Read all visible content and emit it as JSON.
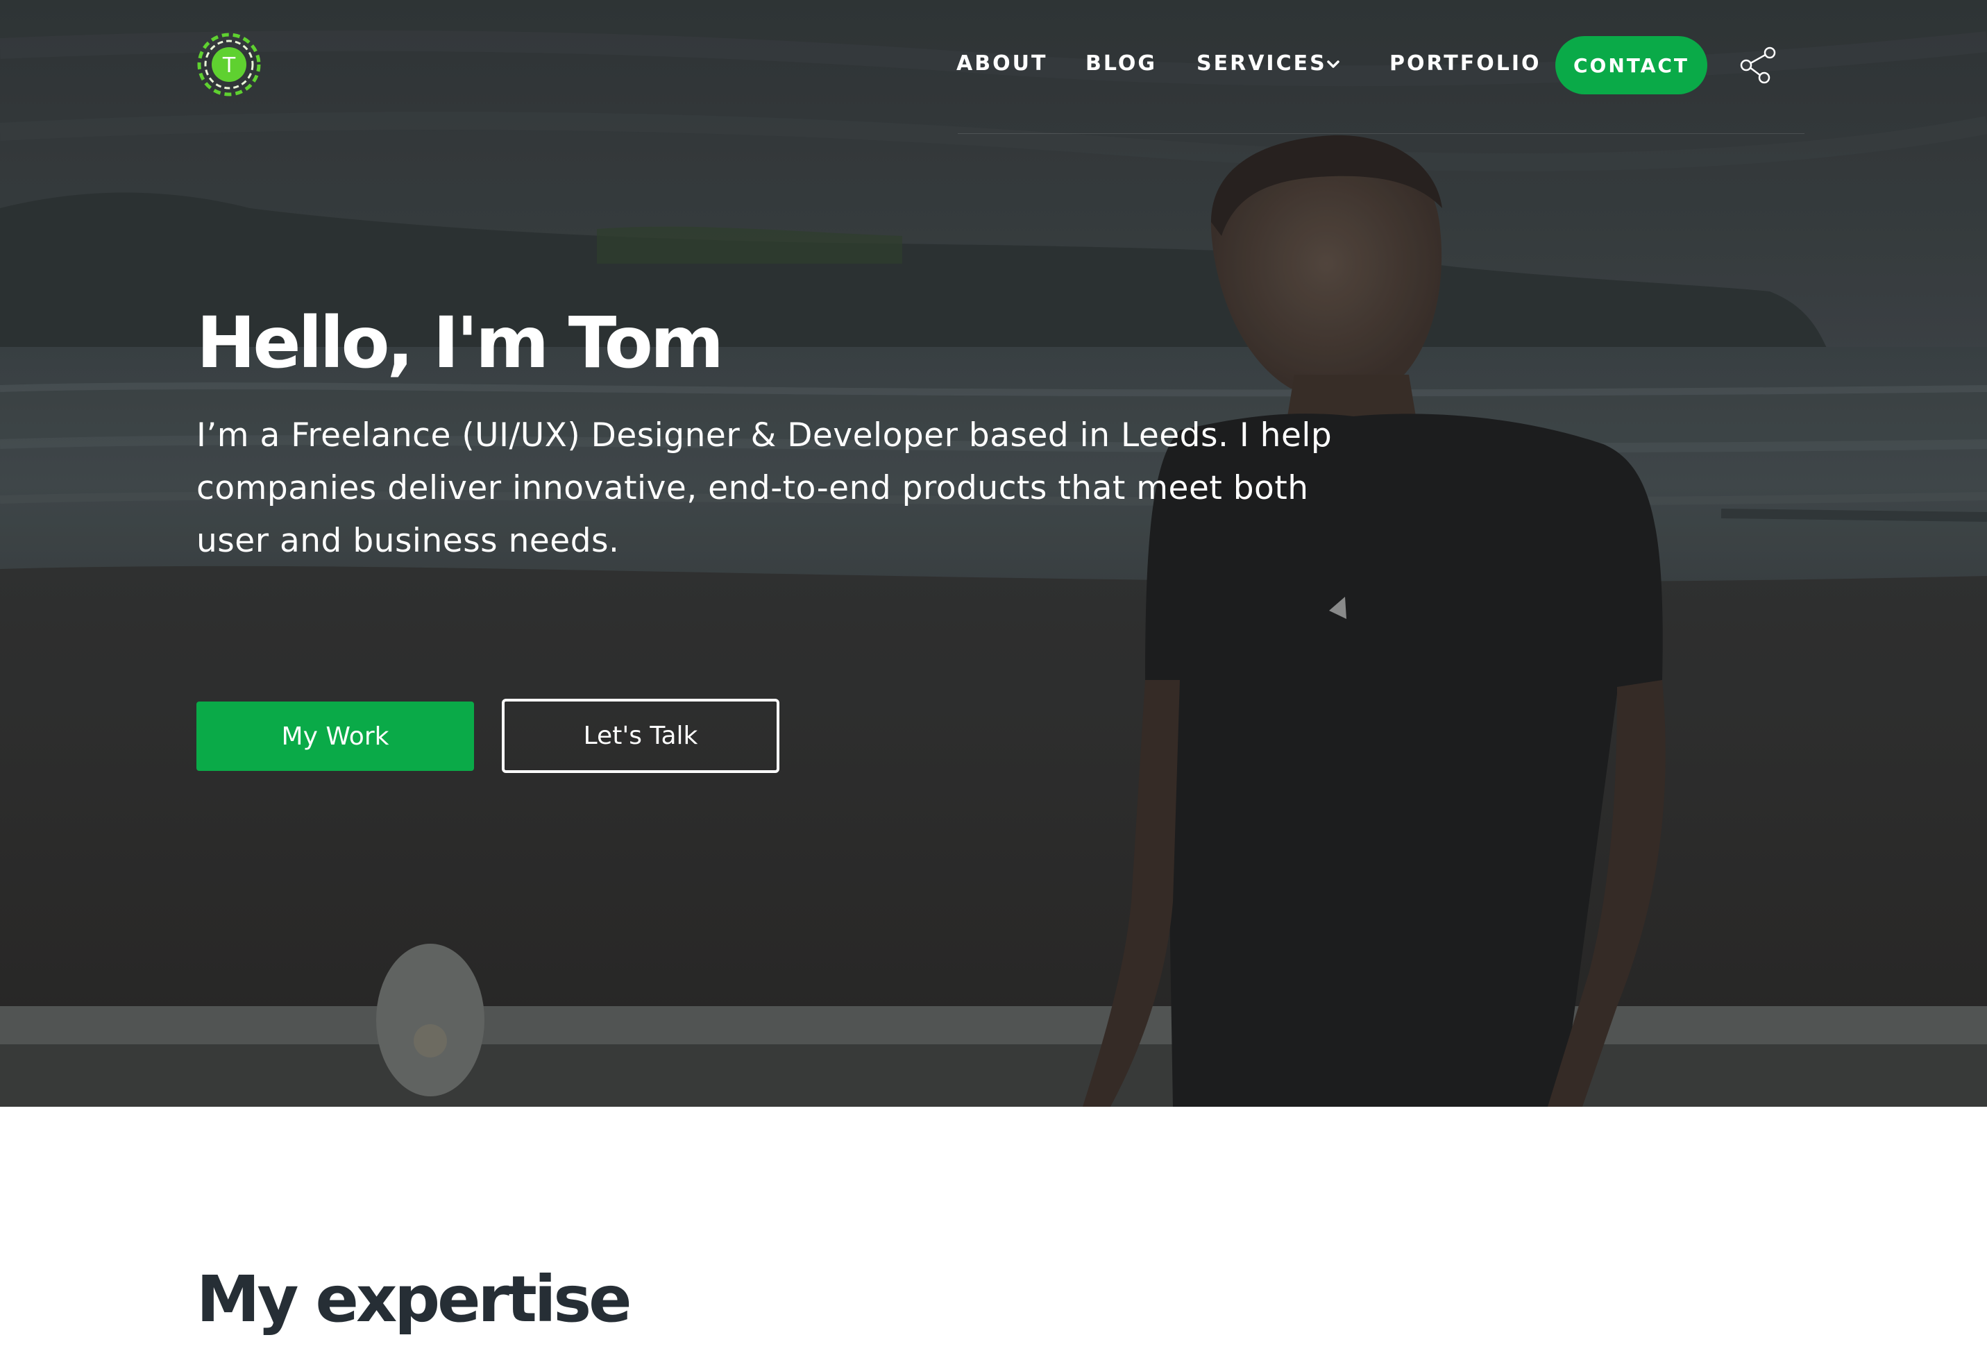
{
  "colors": {
    "accent_green": "#0aaa48",
    "logo_green": "#5fd130",
    "heading_dark": "#262e35"
  },
  "logo": {
    "letter": "T",
    "icon": "logo-badge-icon"
  },
  "nav": {
    "items": [
      {
        "label": "ABOUT"
      },
      {
        "label": "BLOG"
      },
      {
        "label": "SERVICES",
        "icon": "chevron-down-icon"
      },
      {
        "label": "PORTFOLIO"
      }
    ],
    "contact_label": "CONTACT",
    "share_icon": "share-icon"
  },
  "hero": {
    "title": "Hello, I'm Tom",
    "subtitle": "I’m a Freelance (UI/UX) Designer & Developer based in Leeds. I help companies deliver innovative, end-to-end products that meet both user and business needs.",
    "primary_button": "My Work",
    "secondary_button": "Let's Talk"
  },
  "expertise": {
    "title": "My expertise"
  }
}
